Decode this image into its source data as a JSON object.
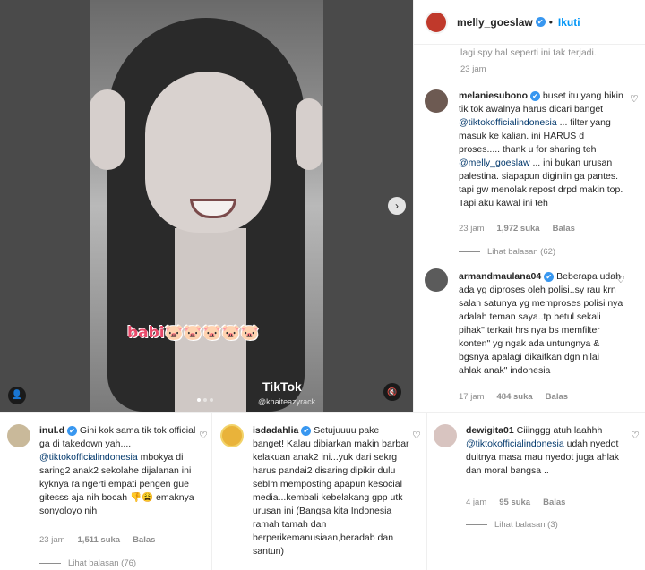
{
  "post": {
    "username": "melly_goeslaw",
    "follow_label": "Ikuti",
    "caption_overlay": "babi🐷🐷🐷🐷🐷",
    "tiktok_label": "TikTok",
    "tiktok_user": "@khaiteazyrack"
  },
  "side_comments": {
    "prev_tail": "lagi spy hal seperti ini tak terjadi.",
    "prev_time": "23 jam",
    "c1": {
      "username": "melaniesubono",
      "text1": " buset itu yang bikin tik tok awalnya harus dicari banget ",
      "mention1": "@tiktokofficialindonesia",
      "text2": " ... filter yang masuk ke kalian. ini HARUS d proses..... thank u for sharing teh ",
      "mention2": "@melly_goeslaw",
      "text3": " ... ini bukan urusan palestina. siapapun diginiin ga pantes. tapi gw menolak repost drpd makin top. Tapi aku kawal ini teh",
      "time": "23 jam",
      "likes": "1,972 suka",
      "reply": "Balas",
      "view_replies": "Lihat balasan (62)"
    },
    "c2": {
      "username": "armandmaulana04",
      "text": " Beberapa udah ada yg diproses oleh polisi..sy rau krn salah satunya yg memproses polisi nya adalah teman saya..tp betul sekali pihak\" terkait hrs nya bs memfilter konten\" yg ngak ada untungnya & bgsnya apalagi dikaitkan dgn nilai ahlak anak\" indonesia",
      "time": "17 jam",
      "likes": "484 suka",
      "reply": "Balas"
    }
  },
  "bottom_comments": {
    "c1": {
      "username": "inul.d",
      "text1": " Gini kok sama tik tok official ga di takedown yah.... ",
      "mention": "@tiktokofficialindonesia",
      "text2": " mbokya di saring2 anak2 sekolahe dijalanan ini kyknya ra ngerti empati pengen gue gitesss aja nih bocah 👎😩 emaknya sonyoloyo nih",
      "time": "23 jam",
      "likes": "1,511 suka",
      "reply": "Balas",
      "view_replies": "Lihat balasan (76)"
    },
    "c2": {
      "username": "isdadahlia",
      "text": " Setujuuuu pake banget! Kalau dibiarkan makin barbar kelakuan anak2 ini...yuk dari sekrg harus pandai2 disaring dipikir dulu seblm memposting apapun kesocial media...kembali kebelakang gpp utk urusan ini (Bangsa kita Indonesia ramah tamah dan berperikemanusiaan,beradab dan santun)"
    },
    "c3": {
      "username": "dewigita01",
      "text1": " Ciiinggg atuh laahhh ",
      "mention": "@tiktokofficialindonesia",
      "text2": " udah nyedot duitnya masa mau nyedot juga ahlak dan moral bangsa ..",
      "time": "4 jam",
      "likes": "95 suka",
      "reply": "Balas",
      "view_replies": "Lihat balasan (3)"
    }
  },
  "icons": {
    "verified": "✔",
    "heart": "♡",
    "next": "›",
    "user_tag": "👤",
    "mute": "🔇"
  }
}
